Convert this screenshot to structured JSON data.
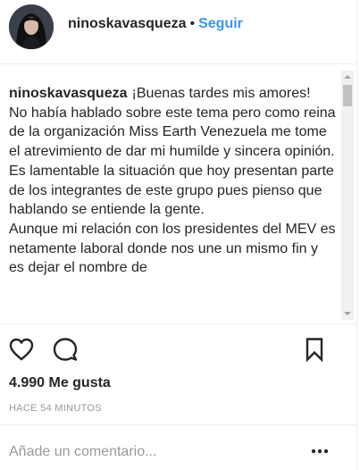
{
  "header": {
    "username": "ninoskavasqueza",
    "separator": "•",
    "follow_label": "Seguir",
    "avatar_icon": "profile-avatar"
  },
  "caption": {
    "username": "ninoskavasqueza",
    "paragraphs": [
      "¡Buenas tardes mis amores!",
      "No había hablado sobre este tema pero como reina de la organización Miss Earth Venezuela me tome el atrevimiento de dar mi humilde y sincera opinión. Es lamentable la situación que hoy presentan parte de los integrantes de este grupo pues pienso que hablando se entiende la gente.",
      "Aunque mi relación con los presidentes del MEV es netamente laboral donde nos une un mismo fin y es dejar el nombre de"
    ]
  },
  "actions": {
    "like_icon": "heart-icon",
    "comment_icon": "comment-icon",
    "save_icon": "bookmark-icon"
  },
  "likes": {
    "text": "4.990 Me gusta"
  },
  "timestamp": {
    "text": "HACE 54 MINUTOS"
  },
  "comment_box": {
    "placeholder": "Añade un comentario...",
    "more_icon": "more-options-icon"
  },
  "colors": {
    "link_blue": "#3897f0",
    "text_dark": "#262626",
    "text_muted": "#999999",
    "divider": "#efefef"
  }
}
